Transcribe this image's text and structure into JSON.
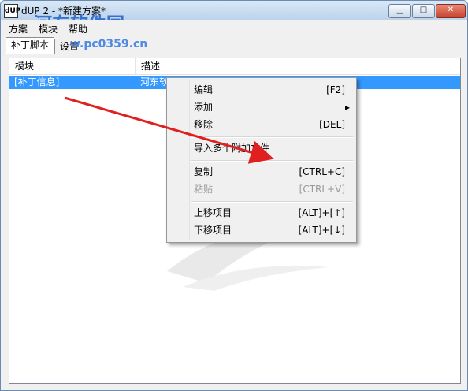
{
  "window": {
    "title": "dUP 2 - *新建方案*",
    "app_icon_text": "dUP",
    "min_glyph": "▁",
    "max_glyph": "□",
    "close_glyph": "✕"
  },
  "watermark": {
    "name": "河东软件园",
    "url": "w.pc0359.cn"
  },
  "menubar": {
    "items": [
      "方案",
      "模块",
      "帮助"
    ]
  },
  "tabs": [
    {
      "label": "补丁脚本"
    },
    {
      "label": "设置"
    }
  ],
  "list": {
    "columns": [
      "模块",
      "描述"
    ],
    "rows": [
      {
        "module": "[补丁信息]",
        "description": "河东软件园",
        "selected": true
      }
    ]
  },
  "context_menu": {
    "items": [
      {
        "label": "编辑",
        "shortcut": "[F2]"
      },
      {
        "label": "添加",
        "shortcut": "▸"
      },
      {
        "label": "移除",
        "shortcut": "[DEL]"
      },
      {
        "label": "导入多个附加文件",
        "shortcut": ""
      },
      {
        "label": "复制",
        "shortcut": "[CTRL+C]"
      },
      {
        "label": "粘贴",
        "shortcut": "[CTRL+V]",
        "disabled": true
      },
      {
        "label": "上移项目",
        "shortcut": "[ALT]+[↑]"
      },
      {
        "label": "下移项目",
        "shortcut": "[ALT]+[↓]"
      }
    ]
  },
  "annotation": {
    "arrow_color": "#e02020"
  }
}
